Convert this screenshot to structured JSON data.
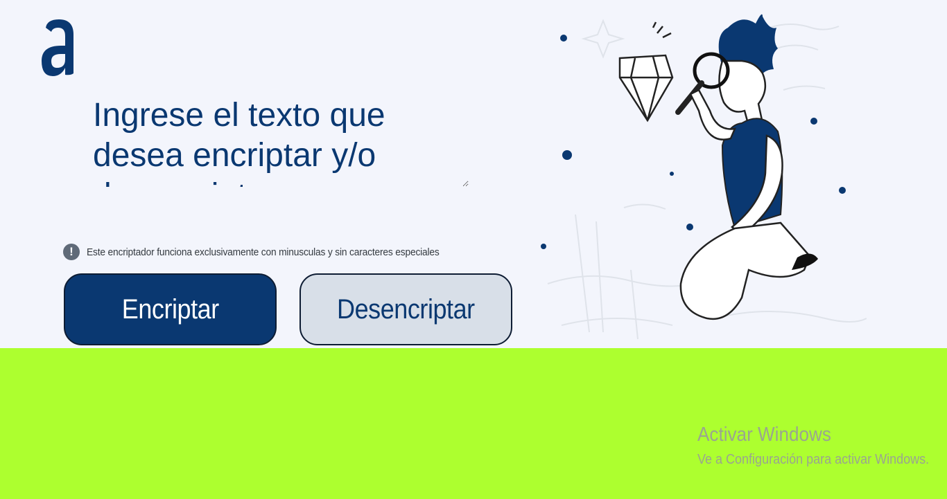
{
  "logo": {
    "icon": "alura-logo",
    "color": "#0a3871"
  },
  "input": {
    "placeholder": "Ingrese el texto que desea encriptar y/o desencriptar",
    "value": ""
  },
  "info": {
    "icon": "exclamation-circle-icon",
    "text": "Este encriptador funciona exclusivamente con minusculas y sin caracteres especiales"
  },
  "buttons": {
    "encrypt_label": "Encriptar",
    "decrypt_label": "Desencriptar"
  },
  "illustration": {
    "subject": "person-with-magnifying-glass-and-diamond"
  },
  "watermark": {
    "title": "Activar Windows",
    "subtitle": "Ve a Configuración para activar Windows."
  },
  "colors": {
    "background": "#f3f5fc",
    "primary": "#0a3871",
    "secondary_button": "#d8dfe8",
    "output_area": "#adff2f"
  }
}
